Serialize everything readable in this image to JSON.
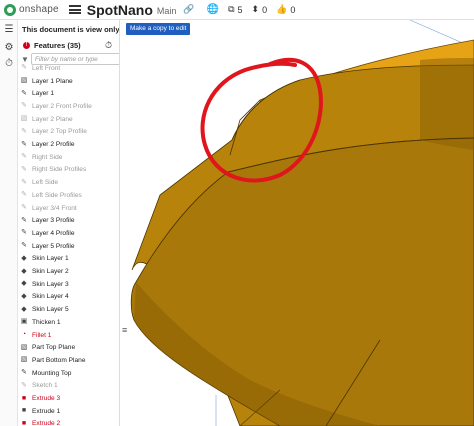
{
  "app": {
    "logo_text": "onshape",
    "doc_title": "SpotNano",
    "branch": "Main",
    "versions_count": "5",
    "branches_count": "0",
    "likes_count": "0"
  },
  "panel": {
    "view_only_text": "This document is view only.",
    "features_label": "Features (35)",
    "filter_placeholder": "Filter by name or type"
  },
  "viewport": {
    "copy_button_label": "Make a copy to edit"
  },
  "features": [
    {
      "label": "Left Front",
      "icon": "sketch-icon",
      "state": "muted"
    },
    {
      "label": "Layer 1 Plane",
      "icon": "plane-icon",
      "state": "normal"
    },
    {
      "label": "Layer 1",
      "icon": "sketch-icon",
      "state": "normal"
    },
    {
      "label": "Layer 2 Front Profile",
      "icon": "sketch-icon",
      "state": "muted"
    },
    {
      "label": "Layer 2 Plane",
      "icon": "plane-icon",
      "state": "muted"
    },
    {
      "label": "Layer 2 Top Profile",
      "icon": "sketch-icon",
      "state": "muted"
    },
    {
      "label": "Layer 2 Profile",
      "icon": "sketch-icon",
      "state": "normal"
    },
    {
      "label": "Right Side",
      "icon": "sketch-icon",
      "state": "muted"
    },
    {
      "label": "Right Side Profiles",
      "icon": "sketch-icon",
      "state": "muted"
    },
    {
      "label": "Left Side",
      "icon": "sketch-icon",
      "state": "muted"
    },
    {
      "label": "Left Side Profiles",
      "icon": "sketch-icon",
      "state": "muted"
    },
    {
      "label": "Layer 3/4 Front",
      "icon": "sketch-icon",
      "state": "muted"
    },
    {
      "label": "Layer 3 Profile",
      "icon": "sketch-icon",
      "state": "normal"
    },
    {
      "label": "Layer 4 Profile",
      "icon": "sketch-icon",
      "state": "normal"
    },
    {
      "label": "Layer 5 Profile",
      "icon": "sketch-icon",
      "state": "normal"
    },
    {
      "label": "Skin Layer 1",
      "icon": "loft-icon",
      "state": "normal"
    },
    {
      "label": "Skin Layer 2",
      "icon": "loft-icon",
      "state": "normal"
    },
    {
      "label": "Skin Layer 3",
      "icon": "loft-icon",
      "state": "normal"
    },
    {
      "label": "Skin Layer 4",
      "icon": "loft-icon",
      "state": "normal"
    },
    {
      "label": "Skin Layer 5",
      "icon": "loft-icon",
      "state": "normal"
    },
    {
      "label": "Thicken 1",
      "icon": "thicken-icon",
      "state": "normal"
    },
    {
      "label": "Fillet 1",
      "icon": "fillet-icon",
      "state": "error"
    },
    {
      "label": "Part Top Plane",
      "icon": "plane-icon",
      "state": "normal"
    },
    {
      "label": "Part Bottom Plane",
      "icon": "plane-icon",
      "state": "normal"
    },
    {
      "label": "Mounting Top",
      "icon": "sketch-icon",
      "state": "normal"
    },
    {
      "label": "Sketch 1",
      "icon": "sketch-icon",
      "state": "muted"
    },
    {
      "label": "Extrude 3",
      "icon": "extrude-icon",
      "state": "error"
    },
    {
      "label": "Extrude 1",
      "icon": "extrude-icon",
      "state": "normal"
    },
    {
      "label": "Extrude 2",
      "icon": "extrude-icon",
      "state": "error"
    }
  ],
  "colors": {
    "part_fill": "#c08a0c",
    "part_fill_dark": "#8a6004",
    "part_edge": "#4a3400",
    "annotation": "#e0161d",
    "button_blue": "#1f5fbf",
    "error_red": "#d0021b"
  }
}
